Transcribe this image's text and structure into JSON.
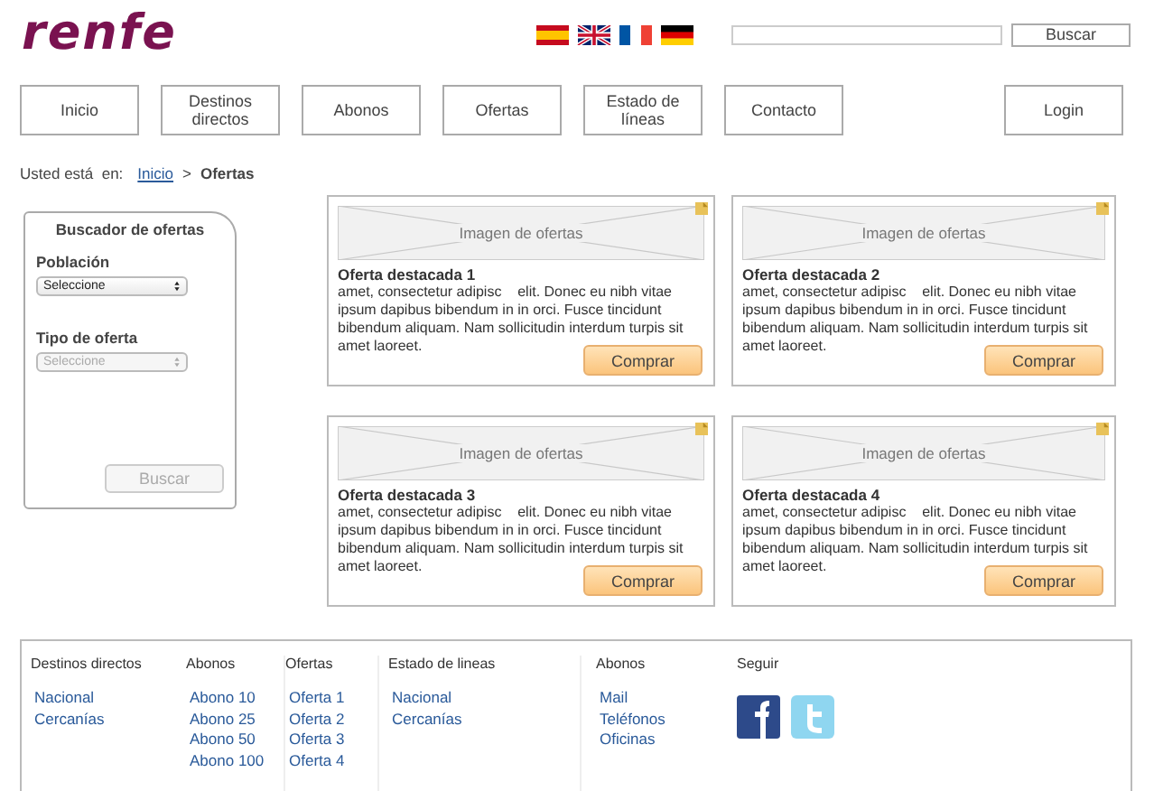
{
  "header": {
    "logo": "renfe",
    "search": {
      "button": "Buscar"
    }
  },
  "nav": {
    "items": [
      "Inicio",
      "Destinos directos",
      "Abonos",
      "Ofertas",
      "Estado de líneas",
      "Contacto"
    ],
    "login": "Login"
  },
  "breadcrumb": {
    "prefix": "Usted está  en:",
    "link": "Inicio",
    "separator": ">",
    "current": "Ofertas"
  },
  "sidebar": {
    "title": "Buscador de ofertas",
    "fields": [
      {
        "label": "Población",
        "value": "Seleccione",
        "disabled": false
      },
      {
        "label": "Tipo de oferta",
        "value": "Seleccione",
        "disabled": true
      }
    ],
    "button": {
      "label": "Buscar",
      "disabled": true
    }
  },
  "offers": [
    {
      "image_label": "Imagen de ofertas",
      "title": "Oferta destacada 1",
      "text": "amet, consectetur adipisc    elit. Donec eu nibh vitae ipsum dapibus bibendum in in orci. Fusce tincidunt bibendum aliquam. Nam sollicitudin interdum turpis sit amet laoreet.",
      "button": "Comprar"
    },
    {
      "image_label": "Imagen de ofertas",
      "title": "Oferta destacada 2",
      "text": "amet, consectetur adipisc    elit. Donec eu nibh vitae ipsum dapibus bibendum in in orci. Fusce tincidunt bibendum aliquam. Nam sollicitudin interdum turpis sit amet laoreet.",
      "button": "Comprar"
    },
    {
      "image_label": "Imagen de ofertas",
      "title": "Oferta destacada 3",
      "text": "amet, consectetur adipisc    elit. Donec eu nibh vitae ipsum dapibus bibendum in in orci. Fusce tincidunt bibendum aliquam. Nam sollicitudin interdum turpis sit amet laoreet.",
      "button": "Comprar"
    },
    {
      "image_label": "Imagen de ofertas",
      "title": "Oferta destacada 4",
      "text": "amet, consectetur adipisc    elit. Donec eu nibh vitae ipsum dapibus bibendum in in orci. Fusce tincidunt bibendum aliquam. Nam sollicitudin interdum turpis sit amet laoreet.",
      "button": "Comprar"
    }
  ],
  "footer": {
    "columns": [
      {
        "kind": "links",
        "heading": "Destinos directos",
        "links": [
          "Nacional",
          "Cercanías"
        ]
      },
      {
        "kind": "links",
        "heading": "Abonos",
        "links": [
          "Abono 10",
          "Abono 25",
          "Abono 50",
          "Abono 100"
        ]
      },
      {
        "kind": "links",
        "heading": "Ofertas",
        "links": [
          "Oferta 1",
          "Oferta 2",
          "Oferta 3",
          "Oferta 4"
        ]
      },
      {
        "kind": "links",
        "heading": "Estado de lineas",
        "links": [
          "Nacional",
          "Cercanías"
        ]
      },
      {
        "kind": "links",
        "heading": "Abonos",
        "links": [
          "Mail",
          "Teléfonos",
          "Oficinas"
        ]
      },
      {
        "kind": "social",
        "heading": "Seguir"
      }
    ]
  }
}
